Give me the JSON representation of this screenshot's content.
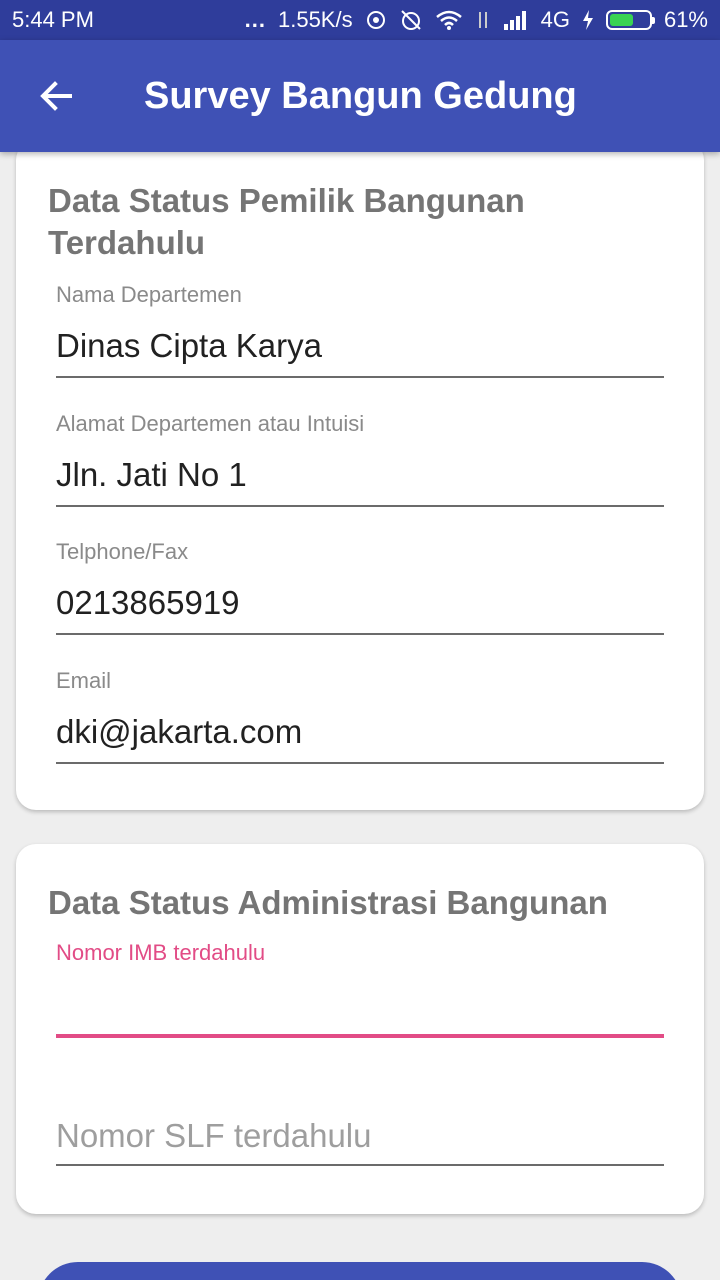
{
  "status_bar": {
    "time": "5:44 PM",
    "dots": "...",
    "speed": "1.55K/s",
    "network": "4G",
    "battery": "61%",
    "battery_level": 0.61
  },
  "app_bar": {
    "back_icon": "arrow-left-icon",
    "title": "Survey Bangun Gedung"
  },
  "card_owner": {
    "title": "Data Status Pemilik Bangunan Terdahulu",
    "fields": [
      {
        "label": "Nama Departemen",
        "value": "Dinas Cipta Karya"
      },
      {
        "label": "Alamat Departemen atau Intuisi",
        "value": "Jln. Jati No 1"
      },
      {
        "label": "Telphone/Fax",
        "value": "0213865919"
      },
      {
        "label": "Email",
        "value": "dki@jakarta.com"
      }
    ]
  },
  "card_admin": {
    "title": "Data Status Administrasi Bangunan",
    "imb": {
      "label": "Nomor IMB terdahulu",
      "value": ""
    },
    "slf": {
      "placeholder": "Nomor SLF terdahulu",
      "value": ""
    }
  },
  "colors": {
    "status_bar": "#2f3d9b",
    "app_bar": "#3f51b5",
    "accent": "#e24c86",
    "background": "#eeeeee"
  }
}
